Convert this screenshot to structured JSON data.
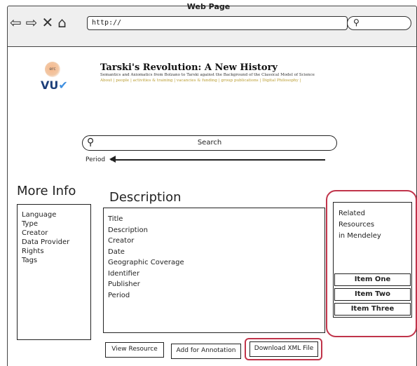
{
  "browser": {
    "title": "Web Page",
    "url": "http://",
    "nav_icons": [
      "back-arrow-icon",
      "forward-arrow-icon",
      "close-icon",
      "home-icon"
    ]
  },
  "header": {
    "erc_logo_text": "erc",
    "vu_logo_text": "VU",
    "site_title": "Tarski's Revolution: A New History",
    "site_subtitle": "Semantics and Axiomatics from Bolzano to Tarski against the Background of the Classical Model of Science",
    "nav_links": "About | people | activities & training | vacancies & funding | group publications | Digital Philosophy |"
  },
  "search": {
    "label": "Search",
    "period_label": "Period"
  },
  "more_info": {
    "title": "More Info",
    "items": [
      "Language",
      "Type",
      "Creator",
      "Data Provider",
      "Rights",
      "Tags"
    ]
  },
  "description": {
    "title": "Description",
    "fields": [
      "Title",
      "Description",
      "Creator",
      "Date",
      "Geographic Coverage",
      "Identifier",
      "Publisher",
      "Period"
    ]
  },
  "related": {
    "lines": [
      "Related",
      "Resources",
      "in Mendeley"
    ],
    "items": [
      "Item One",
      "Item Two",
      "Item Three"
    ]
  },
  "actions": {
    "view_resource": "View Resource",
    "add_annotation": "Add for Annotation",
    "download_xml": "Download XML File"
  },
  "colors": {
    "highlight": "#c0344a",
    "link": "#b89a2c"
  }
}
